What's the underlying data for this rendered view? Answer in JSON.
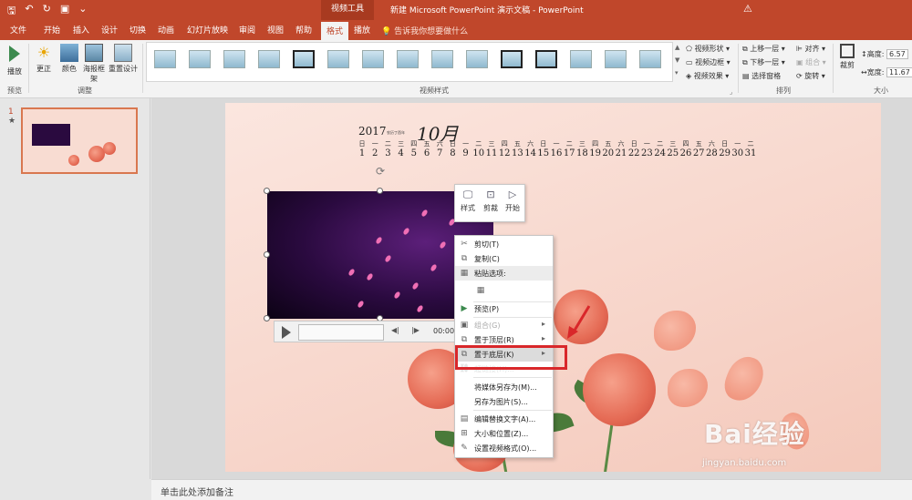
{
  "titlebar": {
    "context_group": "视频工具",
    "doc_title": "新建 Microsoft PowerPoint 演示文稿  -  PowerPoint"
  },
  "tabs": [
    "文件",
    "开始",
    "插入",
    "设计",
    "切换",
    "动画",
    "幻灯片放映",
    "审阅",
    "视图",
    "帮助",
    "格式",
    "播放"
  ],
  "active_tab": "格式",
  "tell_me": "告诉我你想要做什么",
  "ribbon": {
    "preview_btn": "播放",
    "preview_group": "预览",
    "adjust": {
      "correct": "更正",
      "color": "颜色",
      "poster": "海报框架",
      "reset": "重置设计",
      "group": "调整"
    },
    "styles_group": "视频样式",
    "style_opts": {
      "shape": "视频形状",
      "border": "视频边框",
      "effects": "视频效果"
    },
    "arrange": {
      "forward": "上移一层",
      "backward": "下移一层",
      "pane": "选择窗格",
      "align": "对齐",
      "group_btn": "组合",
      "rotate": "旋转",
      "group": "排列"
    },
    "size": {
      "crop": "裁剪",
      "height_label": "高度:",
      "height_val": "6.57",
      "width_label": "宽度:",
      "width_val": "11.67",
      "group": "大小"
    }
  },
  "slide_panel": {
    "number": "1",
    "star": "★"
  },
  "calendar": {
    "year": "2017",
    "sub": "农历丁酉年",
    "month": "10月",
    "weekdays": [
      "日",
      "一",
      "二",
      "三",
      "四",
      "五",
      "六",
      "日",
      "一",
      "二",
      "三",
      "四",
      "五",
      "六",
      "日",
      "一",
      "二",
      "三",
      "四",
      "五",
      "六",
      "日",
      "一",
      "二",
      "三",
      "四",
      "五",
      "六",
      "日",
      "一",
      "二"
    ],
    "days": [
      "1",
      "2",
      "3",
      "4",
      "5",
      "6",
      "7",
      "8",
      "9",
      "10",
      "11",
      "12",
      "13",
      "14",
      "15",
      "16",
      "17",
      "18",
      "19",
      "20",
      "21",
      "22",
      "23",
      "24",
      "25",
      "26",
      "27",
      "28",
      "29",
      "30",
      "31"
    ]
  },
  "video_toolbar": {
    "style": "样式",
    "crop": "剪裁",
    "start": "开始"
  },
  "video_time": "00:00.",
  "context_menu": [
    {
      "label": "剪切(T)",
      "icon": "scissors-icon",
      "glyph": "✂",
      "disabled": false
    },
    {
      "label": "复制(C)",
      "icon": "copy-icon",
      "glyph": "⧉",
      "disabled": false
    },
    {
      "label": "粘贴选项:",
      "icon": "paste-icon",
      "glyph": "📋",
      "disabled": false
    },
    {
      "label": "",
      "icon": "paste-option-icon",
      "glyph": "📋",
      "disabled": false
    },
    {
      "label": "预览(P)",
      "icon": "play-icon",
      "glyph": "▶",
      "disabled": false
    },
    {
      "label": "组合(G)",
      "icon": "group-icon",
      "glyph": "▣",
      "disabled": true
    },
    {
      "label": "置于顶层(R)",
      "icon": "bring-front-icon",
      "glyph": "⧉",
      "disabled": false
    },
    {
      "label": "置于底层(K)",
      "icon": "send-back-icon",
      "glyph": "⧉",
      "disabled": false
    },
    {
      "label": "超链接(H)...",
      "icon": "link-icon",
      "glyph": "🔗",
      "disabled": true
    },
    {
      "label": "将媒体另存为(M)...",
      "icon": "",
      "glyph": "",
      "disabled": false
    },
    {
      "label": "另存为图片(S)...",
      "icon": "",
      "glyph": "",
      "disabled": false
    },
    {
      "label": "编辑替换文字(A)...",
      "icon": "alt-text-icon",
      "glyph": "▤",
      "disabled": false
    },
    {
      "label": "大小和位置(Z)...",
      "icon": "size-position-icon",
      "glyph": "⊞",
      "disabled": false
    },
    {
      "label": "设置视频格式(O)...",
      "icon": "format-video-icon",
      "glyph": "✎",
      "disabled": false
    }
  ],
  "notes_placeholder": "单击此处添加备注",
  "watermark": {
    "brand": "Bai经验",
    "url": "jingyan.baidu.com"
  },
  "colors": {
    "accent": "#c0472b",
    "highlight_box": "#d9272a"
  }
}
